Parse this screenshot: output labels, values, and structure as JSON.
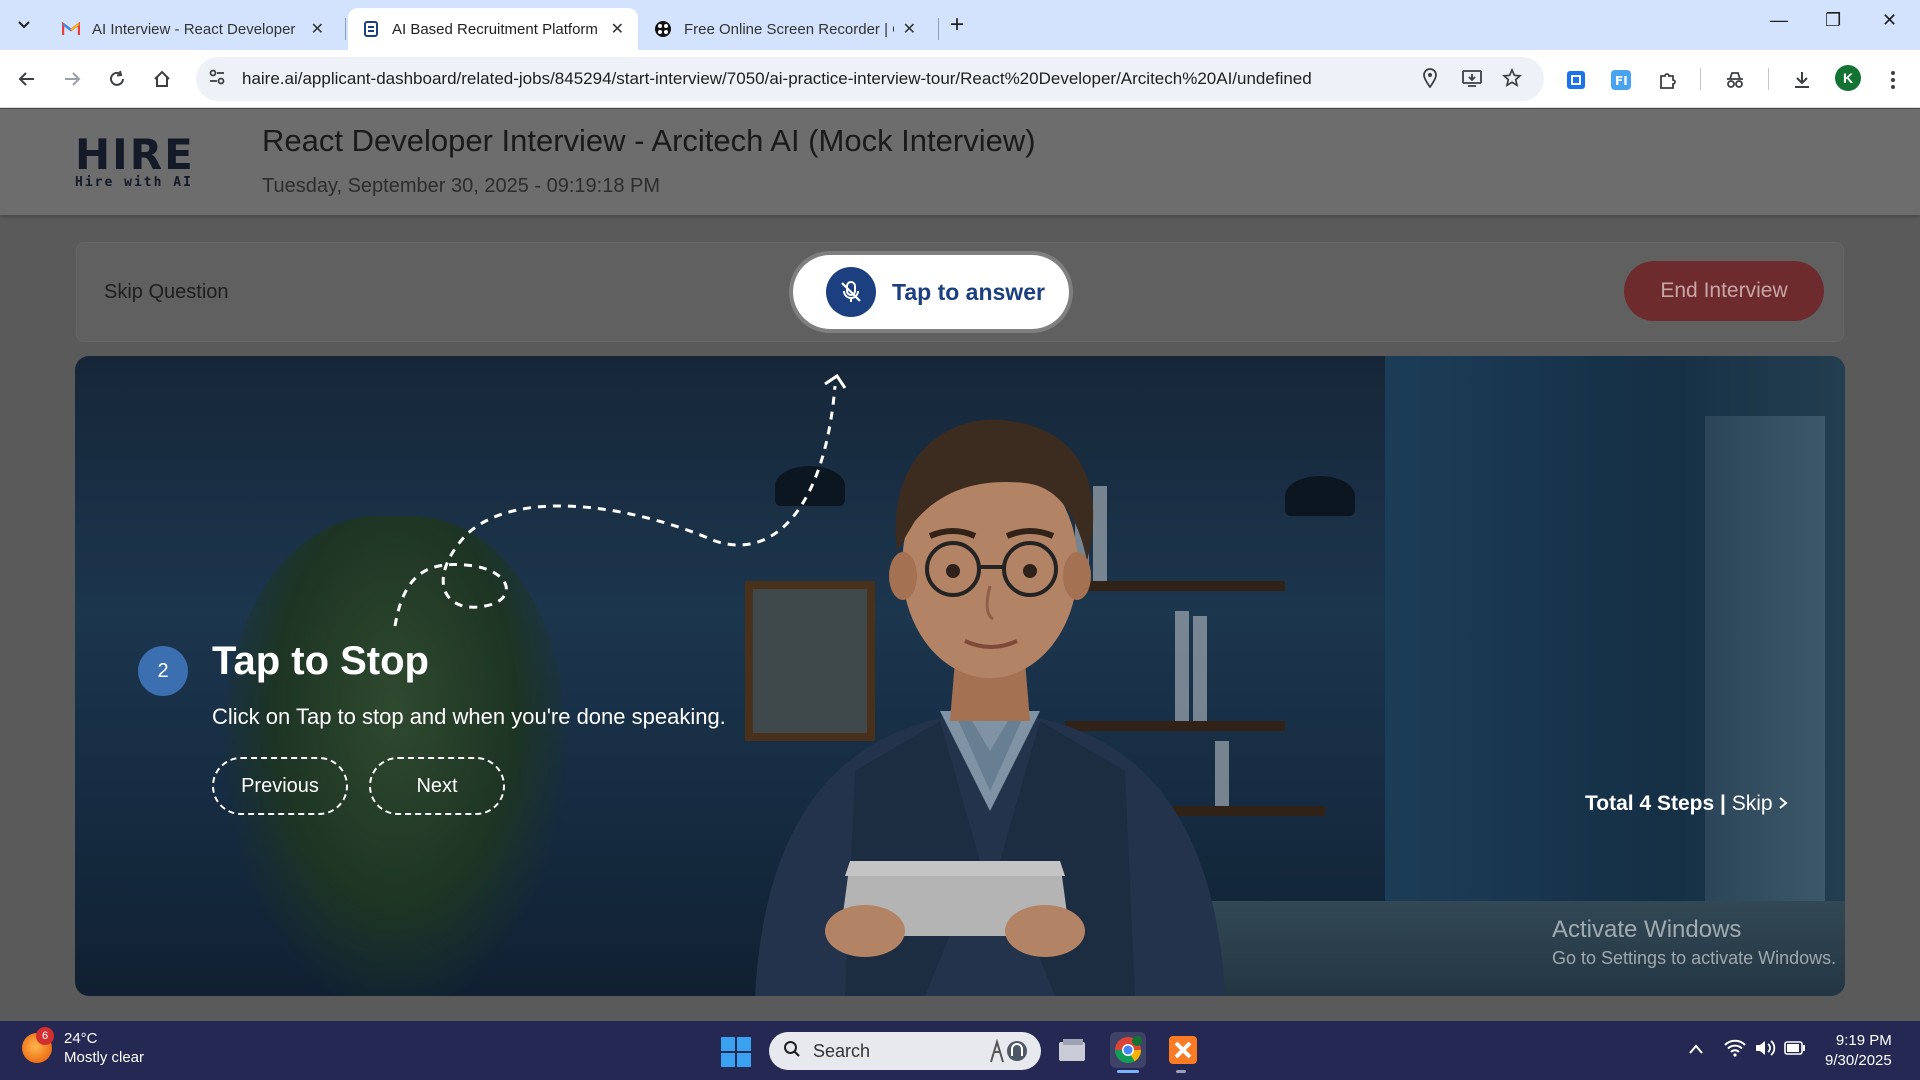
{
  "browser": {
    "tabs": [
      {
        "title": "AI Interview - React Developer",
        "icon": "gmail-icon",
        "active": false
      },
      {
        "title": "AI Based Recruitment Platform |",
        "icon": "haire-icon",
        "active": true
      },
      {
        "title": "Free Online Screen Recorder | C",
        "icon": "recorder-icon",
        "active": false
      }
    ],
    "url": "haire.ai/applicant-dashboard/related-jobs/845294/start-interview/7050/ai-practice-interview-tour/React%20Developer/Arcitech%20AI/undefined",
    "profile_initial": "K"
  },
  "header": {
    "logo_word": "HIRE",
    "logo_tagline": "Hire with AI",
    "title": "React Developer Interview - Arcitech AI (Mock Interview)",
    "datetime": "Tuesday, September 30, 2025 - 09:19:18 PM"
  },
  "controls": {
    "skip_question": "Skip Question",
    "tap_to_answer": "Tap to answer",
    "end_interview": "End Interview"
  },
  "tour": {
    "step_number": "2",
    "step_title": "Tap to Stop",
    "step_description": "Click on Tap to stop and when you're done speaking.",
    "previous_label": "Previous",
    "next_label": "Next",
    "total_steps": "Total 4 Steps",
    "separator": "|",
    "skip_label": "Skip"
  },
  "watermark": {
    "line1": "Activate Windows",
    "line2": "Go to Settings to activate Windows."
  },
  "taskbar": {
    "weather_badge": "6",
    "temperature": "24°C",
    "condition": "Mostly clear",
    "search_label": "Search",
    "time": "9:19 PM",
    "date": "9/30/2025"
  },
  "colors": {
    "brand_blue": "#1b3f7f",
    "end_red": "#6e2b2e",
    "step_badge": "#3c6fb0"
  }
}
